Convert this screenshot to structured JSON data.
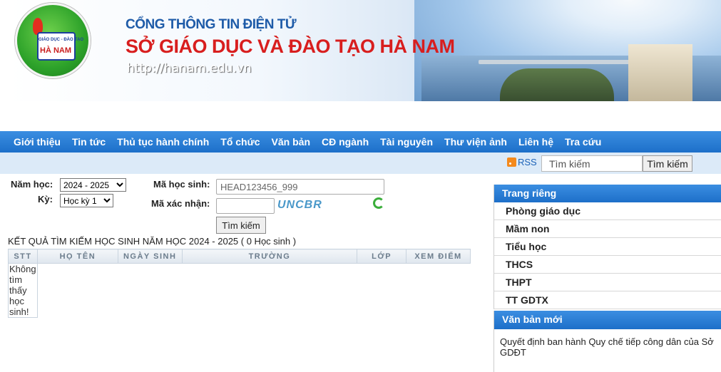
{
  "header": {
    "logo_line1": "GIÁO DỤC - ĐÀO TẠO",
    "logo_line2": "HÀ NAM",
    "title_top": "CỔNG THÔNG TIN ĐIỆN TỬ",
    "title_main": "SỞ GIÁO DỤC VÀ ĐÀO TẠO HÀ NAM",
    "url": "http://hanam.edu.vn"
  },
  "nav": {
    "items": [
      "Giới thiệu",
      "Tin tức",
      "Thủ tục hành chính",
      "Tổ chức",
      "Văn bản",
      "CĐ ngành",
      "Tài nguyên",
      "Thư viện ảnh",
      "Liên hệ",
      "Tra cứu"
    ]
  },
  "subbar": {
    "rss_label": "RSS",
    "search_placeholder": "Tìm kiếm",
    "search_button": "Tìm kiếm",
    "rss_color": "#f48a1d"
  },
  "form": {
    "year_label": "Năm học:",
    "year_value": "2024 - 2025",
    "term_label": "Kỳ:",
    "term_value": "Học kỳ 1",
    "student_id_label": "Mã học sinh:",
    "student_id_value": "HEAD123456_999",
    "captcha_label": "Mã xác nhận:",
    "captcha_value": "",
    "captcha_text": "UNCBR",
    "search_button": "Tìm kiếm"
  },
  "results": {
    "title": "KẾT QUẢ TÌM KIẾM HỌC SINH NĂM HỌC 2024 - 2025 ( 0 Học sinh )",
    "columns": [
      "STT",
      "Họ tên",
      "Ngày sinh",
      "Trường",
      "Lớp",
      "Xem điểm"
    ],
    "empty_message": "Không tìm thấy học sinh!"
  },
  "sidebar": {
    "private_title": "Trang riêng",
    "private_items": [
      "Phòng giáo dục",
      "Mầm non",
      "Tiểu học",
      "THCS",
      "THPT",
      "TT GDTX"
    ],
    "news_title": "Văn bản mới",
    "news_text": "Quyết định ban hành Quy chế tiếp công dân của Sở GDĐT"
  },
  "colors": {
    "nav_blue": "#1d6fc9",
    "title_red": "#d81e1e",
    "title_blue": "#1e5ba8"
  }
}
